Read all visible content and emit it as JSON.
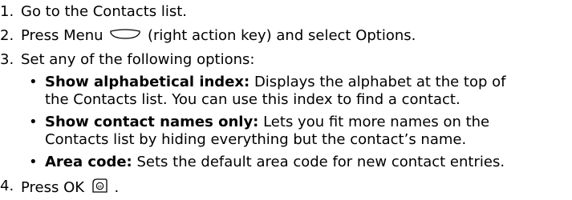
{
  "steps": [
    {
      "num": "1.",
      "text": "Go to the Contacts list."
    },
    {
      "num": "2.",
      "text_before": "Press Menu",
      "text_after": "(right action key) and select Options."
    },
    {
      "num": "3.",
      "text": "Set any of the following options:"
    },
    {
      "num": "4.",
      "text_before": "Press OK",
      "text_after": "."
    }
  ],
  "options": [
    {
      "bullet": "•",
      "label": "Show alphabetical index:",
      "desc": " Displays the alphabet at the top of",
      "desc2": "the Contacts list. You can use this index to find a contact."
    },
    {
      "bullet": "•",
      "label": "Show contact names only:",
      "desc": " Lets you fit more names on the",
      "desc2": "Contacts list by hiding everything but the contact’s name."
    },
    {
      "bullet": "•",
      "label": "Area code:",
      "desc": " Sets the default area code for new contact entries."
    }
  ],
  "icons": {
    "menu_key": "right-action-key-icon",
    "ok_key": "ok-key-icon"
  }
}
